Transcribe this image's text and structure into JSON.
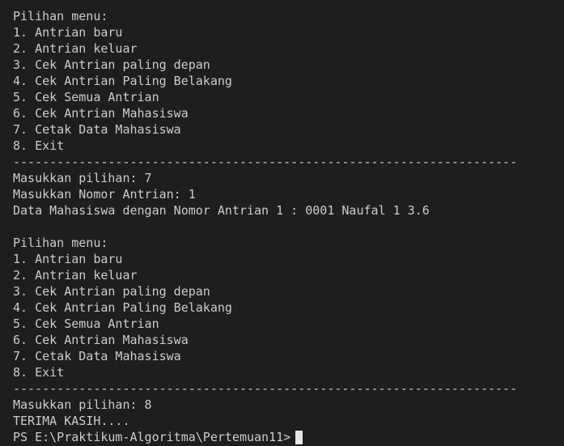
{
  "terminal": {
    "block1": {
      "menu_title": "Pilihan menu:",
      "menu_items": [
        "1. Antrian baru",
        "2. Antrian keluar",
        "3. Cek Antrian paling depan",
        "4. Cek Antrian Paling Belakang",
        "5. Cek Semua Antrian",
        "6. Cek Antrian Mahasiswa",
        "7. Cetak Data Mahasiswa",
        "8. Exit"
      ],
      "separator": "---------------------------------------------------------------------",
      "input_choice": "Masukkan pilihan: 7",
      "input_number": "Masukkan Nomor Antrian: 1",
      "result": "Data Mahasiswa dengan Nomor Antrian 1 : 0001 Naufal 1 3.6"
    },
    "block2": {
      "menu_title": "Pilihan menu:",
      "menu_items": [
        "1. Antrian baru",
        "2. Antrian keluar",
        "3. Cek Antrian paling depan",
        "4. Cek Antrian Paling Belakang",
        "5. Cek Semua Antrian",
        "6. Cek Antrian Mahasiswa",
        "7. Cetak Data Mahasiswa",
        "8. Exit"
      ],
      "separator": "---------------------------------------------------------------------",
      "input_choice": "Masukkan pilihan: 8",
      "goodbye": "TERIMA KASIH...."
    },
    "prompt": "PS E:\\Praktikum-Algoritma\\Pertemuan11>",
    "colors": {
      "background": "#1e1e1e",
      "foreground": "#cccccc",
      "cursor": "#e6e6e6"
    }
  }
}
